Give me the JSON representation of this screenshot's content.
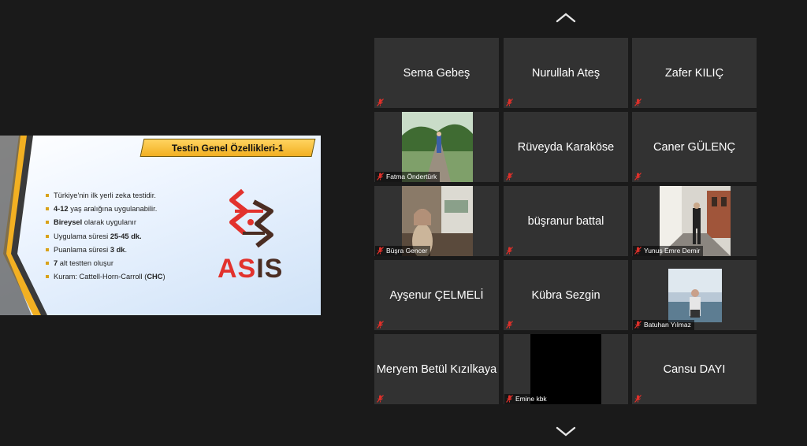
{
  "slide": {
    "title": "Testin Genel Özellikleri-1",
    "bullets": [
      {
        "parts": [
          {
            "t": "Türkiye'nin ilk yerli zeka testidir.",
            "b": false
          }
        ]
      },
      {
        "parts": [
          {
            "t": "4-12",
            "b": true
          },
          {
            "t": " yaş aralığına uygulanabilir.",
            "b": false
          }
        ]
      },
      {
        "parts": [
          {
            "t": "Bireysel",
            "b": true
          },
          {
            "t": " olarak uygulanır",
            "b": false
          }
        ]
      },
      {
        "parts": [
          {
            "t": "Uygulama süresi ",
            "b": false
          },
          {
            "t": "25-45 dk.",
            "b": true
          }
        ]
      },
      {
        "parts": [
          {
            "t": "Puanlama süresi ",
            "b": false
          },
          {
            "t": "3 dk",
            "b": true
          },
          {
            "t": ".",
            "b": false
          }
        ]
      },
      {
        "parts": [
          {
            "t": "7",
            "b": true
          },
          {
            "t": " alt testten oluşur",
            "b": false
          }
        ]
      },
      {
        "parts": [
          {
            "t": "Kuram: Cattell-Horn-Carroll (",
            "b": false
          },
          {
            "t": "CHC",
            "b": true
          },
          {
            "t": ")",
            "b": false
          }
        ]
      }
    ],
    "logo_part1": "AS",
    "logo_part2": "IS"
  },
  "nav": {
    "up_icon": "chevron-up-icon",
    "down_icon": "chevron-down-icon"
  },
  "participants": [
    {
      "name": "Sema Gebeş",
      "video": false,
      "muted": true
    },
    {
      "name": "Nurullah Ateş",
      "video": false,
      "muted": true
    },
    {
      "name": "Zafer KILIÇ",
      "video": false,
      "muted": true
    },
    {
      "name": "Fatma Öndertürk",
      "video": true,
      "muted": true
    },
    {
      "name": "Rüveyda Karaköse",
      "video": false,
      "muted": true
    },
    {
      "name": "Caner GÜLENÇ",
      "video": false,
      "muted": true
    },
    {
      "name": "Büşra Gencer",
      "video": true,
      "muted": true
    },
    {
      "name": "büşranur battal",
      "video": false,
      "muted": true
    },
    {
      "name": "Yunus Emre Demir",
      "video": true,
      "muted": true
    },
    {
      "name": "Ayşenur ÇELMELİ",
      "video": false,
      "muted": true
    },
    {
      "name": "Kübra Sezgin",
      "video": false,
      "muted": true
    },
    {
      "name": "Batuhan Yılmaz",
      "video": true,
      "muted": true
    },
    {
      "name": "Meryem Betül Kızılkaya",
      "video": false,
      "muted": true
    },
    {
      "name": "Emine kbk",
      "video": true,
      "muted": true
    },
    {
      "name": "Cansu DAYI",
      "video": false,
      "muted": true
    }
  ],
  "colors": {
    "tile_bg": "#323232",
    "background": "#1a1a1a",
    "mute_icon": "#e0302a",
    "slide_accent": "#f2b022"
  }
}
